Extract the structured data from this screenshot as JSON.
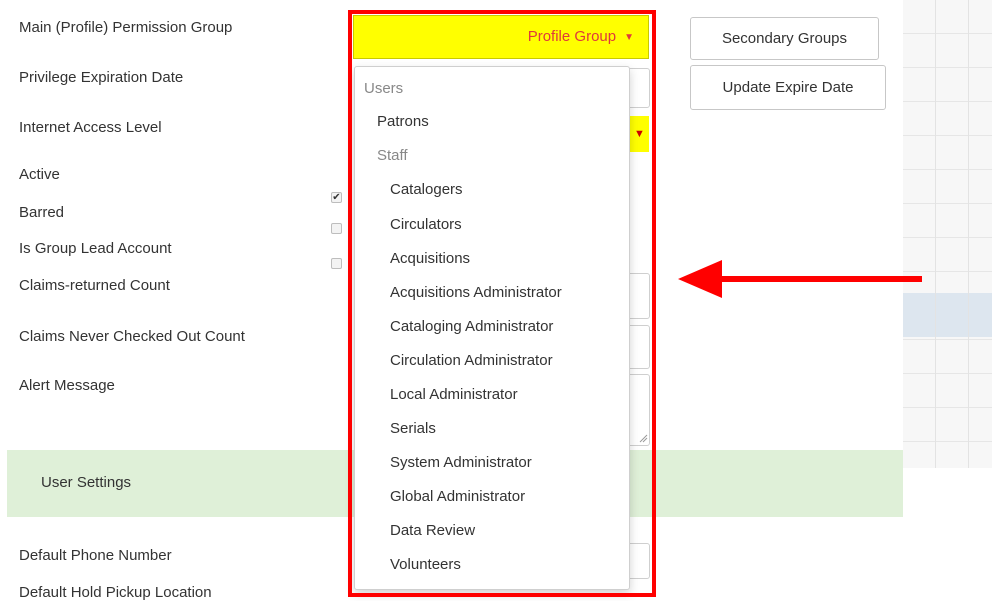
{
  "form": {
    "labels": {
      "main_permission_group": "Main (Profile) Permission Group",
      "privilege_expiration_date": "Privilege Expiration Date",
      "internet_access_level": "Internet Access Level",
      "active": "Active",
      "barred": "Barred",
      "is_group_lead_account": "Is Group Lead Account",
      "claims_returned_count": "Claims-returned Count",
      "claims_never_checked_out_count": "Claims Never Checked Out Count",
      "alert_message": "Alert Message",
      "default_phone_number": "Default Phone Number",
      "default_hold_pickup_location": "Default Hold Pickup Location"
    },
    "checkboxes": {
      "active_checked": true,
      "barred_checked": false,
      "group_lead_checked": false
    },
    "section_title": "User Settings"
  },
  "dropdown": {
    "selected_label": "Profile Group",
    "caret": "▼",
    "items": [
      {
        "label": "Users"
      },
      {
        "label": "Patrons"
      },
      {
        "label": "Staff"
      },
      {
        "label": "Catalogers"
      },
      {
        "label": "Circulators"
      },
      {
        "label": "Acquisitions"
      },
      {
        "label": "Acquisitions Administrator"
      },
      {
        "label": "Cataloging Administrator"
      },
      {
        "label": "Circulation Administrator"
      },
      {
        "label": "Local Administrator"
      },
      {
        "label": "Serials"
      },
      {
        "label": "System Administrator"
      },
      {
        "label": "Global Administrator"
      },
      {
        "label": "Data Review"
      },
      {
        "label": "Volunteers"
      }
    ]
  },
  "buttons": {
    "secondary_groups": "Secondary Groups",
    "update_expire_date": "Update Expire Date"
  },
  "colors": {
    "highlight_frame": "#ff0000",
    "toggle_bg": "#ffff00",
    "toggle_text": "#e0393b",
    "section_bg": "#dff0d8",
    "arrow": "#ff0000"
  }
}
